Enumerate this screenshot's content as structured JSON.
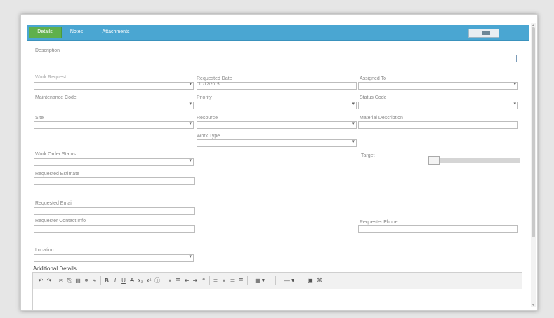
{
  "tabs": [
    {
      "label": "Details"
    },
    {
      "label": "Notes"
    },
    {
      "label": "Attachments"
    }
  ],
  "labels": {
    "description": "Description",
    "request_type": "Work Request",
    "requested_date": "Requested Date",
    "assigned_to": "Assigned To",
    "maintenance_code": "Maintenance Code",
    "priority": "Priority",
    "status_code": "Status Code",
    "site": "Site",
    "resource": "Resource",
    "material_description": "Material Description",
    "work_type": "Work Type",
    "work_order_status": "Work Order Status",
    "target": "Target",
    "requested_estimate": "Requested Estimate",
    "requested_email": "Requested Email",
    "requested_contact": "Requester Contact Info",
    "requester_phone": "Requester Phone",
    "location": "Location",
    "additional_details": "Additional Details"
  },
  "values": {
    "requested_date": "11/12/2015"
  },
  "slider": {
    "value_fraction": 0.05
  },
  "toolbar_icons": [
    "undo-icon",
    "redo-icon",
    "cut-icon",
    "copy-icon",
    "paste-icon",
    "link-icon",
    "unlink-icon",
    "bold-icon",
    "italic-icon",
    "underline-icon",
    "strike-icon",
    "subscript-icon",
    "superscript-icon",
    "clear-format-icon",
    "ordered-list-icon",
    "unordered-list-icon",
    "outdent-icon",
    "indent-icon",
    "blockquote-icon",
    "align-left-icon",
    "align-center-icon",
    "align-right-icon",
    "justify-icon",
    "table-icon",
    "hr-icon",
    "image-icon",
    "source-icon"
  ],
  "colors": {
    "tabbar": "#4aa6d2",
    "active_tab": "#5fb04c"
  }
}
